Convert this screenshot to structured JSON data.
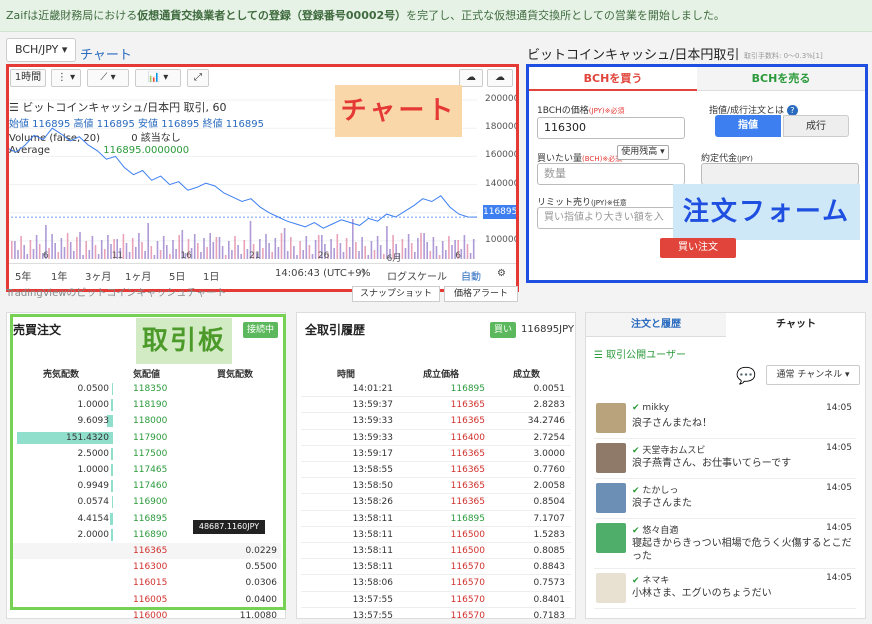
{
  "banner": {
    "prefix": "Zaifは近畿財務局における",
    "bold": "仮想通貨交換業者としての登録（登録番号00002号）",
    "suffix": "を完了し、正式な仮想通貨交換所としての営業を開始しました。"
  },
  "pair_selector": "BCH/JPY ▾",
  "chart_tab": "チャート",
  "chart": {
    "toolbar": {
      "interval": "1時間",
      "more": "⋮ ▾",
      "line": "⟋ ▾",
      "indicators": "📊 ▾",
      "fullscreen": "⤢"
    },
    "legend_title": "☰ ビットコインキャッシュ/日本円 取引, 60",
    "legend_ohlc": "始値 116895 高値 116895 安値 116895 終値 116895",
    "legend_volume": "Volume (false, 20)",
    "legend_volume_value": "0 該当なし",
    "legend_average": "Average",
    "legend_average_value": "116895.0000000",
    "current_price_label": "116895",
    "bottom": {
      "ranges": [
        "5年",
        "1年",
        "3ヶ月",
        "1ヶ月",
        "5日",
        "1日"
      ],
      "clock": "14:06:43 (UTC+9)",
      "percent": "%",
      "log": "ログスケール",
      "auto": "自動",
      "settings": "⚙"
    },
    "tradingview_link": "TradingViewのビットコインキャッシュチャート",
    "snapshot": "スナップショット",
    "price_alert": "価格アラート"
  },
  "chart_data": {
    "type": "line",
    "x": [
      "6",
      "11",
      "16",
      "21",
      "26",
      "6月",
      "6"
    ],
    "y_ticks": [
      100000,
      120000,
      140000,
      160000,
      180000,
      200000
    ],
    "ylim": [
      90000,
      205000
    ],
    "series": [
      {
        "values": [
          166000,
          163000,
          168000,
          175000,
          172000,
          180000,
          176000,
          171000,
          174000,
          168000,
          164000,
          158000,
          160000,
          152000,
          147000,
          150000,
          143000,
          146000,
          140000,
          142000,
          136000,
          138000,
          141000,
          139000,
          134000,
          131000,
          128000,
          130000,
          124000,
          120000,
          117000,
          114000,
          112000,
          110000,
          113000,
          109000,
          112000,
          115000,
          113000,
          111000,
          116000,
          114000,
          119000,
          117000,
          121000,
          125000,
          130000,
          128000,
          132000,
          124000,
          119000,
          117000,
          116895
        ]
      }
    ]
  },
  "chart_caption": "チャート",
  "order_form": {
    "title": "ビットコインキャッシュ/日本円取引",
    "fee": "取引手数料: 0〜0.3%[1]",
    "tab_buy": "BCHを買う",
    "tab_sell": "BCHを売る",
    "price_label": "1BCHの価格",
    "price_unit": "(JPY)",
    "required": "※必須",
    "price_value": "116300",
    "type_label": "指値/成行注文とは",
    "limit_button": "指値",
    "market_button": "成行",
    "amount_label": "買いたい量",
    "amount_unit": "(BCH)",
    "balance_button": "使用残高 ▾",
    "amount_placeholder": "数量",
    "total_label": "約定代金",
    "total_unit": "(JPY)",
    "limit_label": "リミット売り",
    "limit_unit": "(JPY)",
    "optional": "※任意",
    "limit_placeholder": "買い指値より大きい額を入",
    "buy_order_button": "買い注文"
  },
  "form_caption": "注文フォーム",
  "orderbook": {
    "title": "売買注文",
    "status": "接続中",
    "headers": [
      "売気配数",
      "気配値",
      "買気配数"
    ],
    "asks": [
      {
        "qty": "0.0500",
        "price": "118350",
        "depth": 0.01
      },
      {
        "qty": "1.0000",
        "price": "118190",
        "depth": 0.02
      },
      {
        "qty": "9.6093",
        "price": "118000",
        "depth": 0.06
      },
      {
        "qty": "151.4320",
        "price": "117900",
        "depth": 1.0
      },
      {
        "qty": "2.5000",
        "price": "117500",
        "depth": 0.02
      },
      {
        "qty": "1.0000",
        "price": "117465",
        "depth": 0.02
      },
      {
        "qty": "0.9949",
        "price": "117460",
        "depth": 0.02
      },
      {
        "qty": "0.0574",
        "price": "116900",
        "depth": 0.01
      },
      {
        "qty": "4.4154",
        "price": "116895",
        "depth": 0.03
      },
      {
        "qty": "2.0000",
        "price": "116890",
        "depth": 0.02
      }
    ],
    "bids": [
      {
        "price": "116365",
        "qty": "0.0229"
      },
      {
        "price": "116300",
        "qty": "0.5500"
      },
      {
        "price": "116015",
        "qty": "0.0306"
      },
      {
        "price": "116005",
        "qty": "0.0400"
      },
      {
        "price": "116000",
        "qty": "11.0080"
      }
    ],
    "tooltip": "48687.1160JPY"
  },
  "book_caption": "取引板",
  "history": {
    "title": "全取引履歴",
    "last_side": "買い",
    "last_price": "116895JPY",
    "headers": [
      "時間",
      "成立価格",
      "成立数"
    ],
    "rows": [
      {
        "time": "14:01:21",
        "price": "116895",
        "qty": "0.0051",
        "side": "buy"
      },
      {
        "time": "13:59:37",
        "price": "116365",
        "qty": "2.8283",
        "side": "sell"
      },
      {
        "time": "13:59:33",
        "price": "116365",
        "qty": "34.2746",
        "side": "sell"
      },
      {
        "time": "13:59:33",
        "price": "116400",
        "qty": "2.7254",
        "side": "sell"
      },
      {
        "time": "13:59:17",
        "price": "116365",
        "qty": "3.0000",
        "side": "sell"
      },
      {
        "time": "13:58:55",
        "price": "116365",
        "qty": "0.7760",
        "side": "sell"
      },
      {
        "time": "13:58:50",
        "price": "116365",
        "qty": "2.0058",
        "side": "sell"
      },
      {
        "time": "13:58:26",
        "price": "116365",
        "qty": "0.8504",
        "side": "sell"
      },
      {
        "time": "13:58:11",
        "price": "116895",
        "qty": "7.1707",
        "side": "buy"
      },
      {
        "time": "13:58:11",
        "price": "116500",
        "qty": "1.5283",
        "side": "sell"
      },
      {
        "time": "13:58:11",
        "price": "116500",
        "qty": "0.8085",
        "side": "sell"
      },
      {
        "time": "13:58:11",
        "price": "116570",
        "qty": "0.8843",
        "side": "sell"
      },
      {
        "time": "13:58:06",
        "price": "116570",
        "qty": "0.7573",
        "side": "sell"
      },
      {
        "time": "13:57:55",
        "price": "116570",
        "qty": "0.8401",
        "side": "sell"
      },
      {
        "time": "13:57:55",
        "price": "116570",
        "qty": "0.7183",
        "side": "sell"
      }
    ]
  },
  "chat": {
    "tab_notes": "注文と履歴",
    "tab_chat": "チャット",
    "public_users": "取引公開ユーザー",
    "channel": "通常 チャンネル ▾",
    "messages": [
      {
        "user": "mikky",
        "time": "14:05",
        "text": "浪子さんまたね！",
        "avatar_color": "#b9a37c"
      },
      {
        "user": "天堂寺おムスビ",
        "time": "14:05",
        "text": "浪子燕青さん、お仕事いてらーです",
        "avatar_color": "#8f7a6a"
      },
      {
        "user": "たかしっ",
        "time": "14:05",
        "text": "浪子さんまた",
        "avatar_color": "#6b8fb5"
      },
      {
        "user": "悠々自適",
        "time": "14:05",
        "text": "寝起きからきっつい相場で危うく火傷するとこだった",
        "avatar_color": "#4fae6a"
      },
      {
        "user": "ネマキ",
        "time": "14:05",
        "text": "小林さま、エグいのちょうだい",
        "avatar_color": "#e8e0d0"
      }
    ]
  },
  "colors": {
    "green": "#5cb85c",
    "red": "#d0312d",
    "blue": "#3d7ff0",
    "chart_line": "#3d7ff0"
  }
}
